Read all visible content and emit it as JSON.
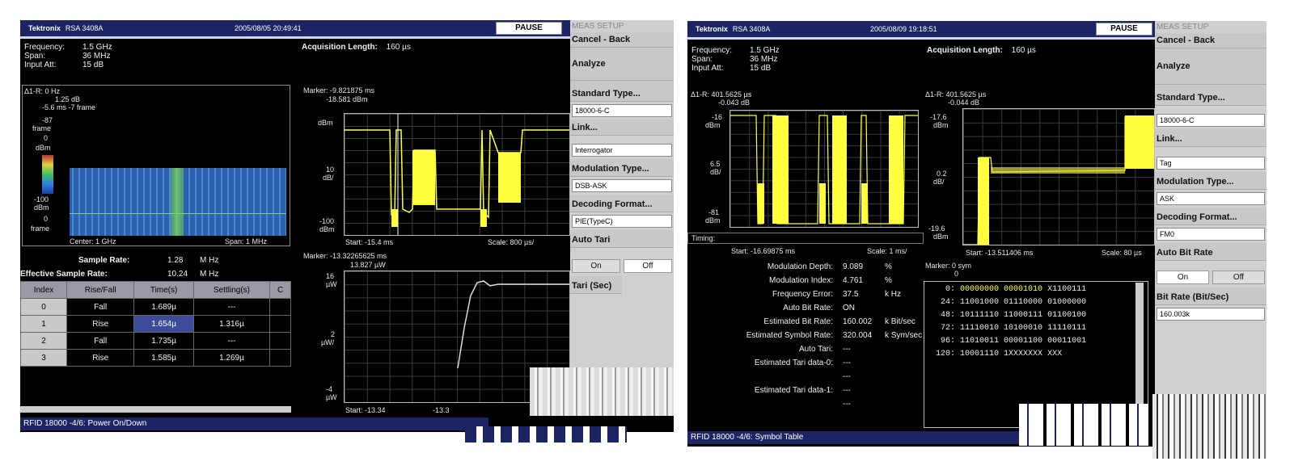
{
  "screens": [
    {
      "brand": "Tektronix",
      "model": "RSA 3408A",
      "timestamp": "2005/08/05 20:49:41",
      "pause": "PAUSE",
      "info": [
        {
          "k": "Frequency:",
          "v": "1.5 GHz"
        },
        {
          "k": "Span:",
          "v": "36 MHz"
        },
        {
          "k": "Input Att:",
          "v": "15 dB"
        }
      ],
      "acq_label": "Acquisition Length:",
      "acq_value": "160 µs",
      "spectro": {
        "line1": "Δ1-R: 0 Hz",
        "line2": "1.25 dB",
        "line3": "-5.6 ms  -7 frame",
        "ticks": [
          "-87",
          "frame",
          "0",
          "dBm",
          "-100",
          "dBm",
          "0",
          "frame"
        ],
        "center": "Center: 1 GHz",
        "span": "Span: 1 MHz"
      },
      "rate": {
        "sample_k": "Sample Rate:",
        "sample_v": "1.28",
        "sample_u": "M Hz",
        "eff_k": "Effective Sample Rate:",
        "eff_v": "10.24",
        "eff_u": "M Hz"
      },
      "table": {
        "headers": [
          "Index",
          "Rise/Fall",
          "Time(s)",
          "Settling(s)",
          "C"
        ],
        "rows": [
          [
            "0",
            "Fall",
            "1.689µ",
            "---"
          ],
          [
            "1",
            "Rise",
            "1.654µ",
            "1.316µ"
          ],
          [
            "2",
            "Fall",
            "1.735µ",
            "---"
          ],
          [
            "3",
            "Rise",
            "1.585µ",
            "1.269µ"
          ]
        ]
      },
      "top_plot": {
        "marker1": "Marker: -9.821875 ms",
        "marker2": "-18.581 dBm",
        "y": [
          "dBm",
          "10",
          "dB/",
          "-100",
          "dBm"
        ],
        "start": "Start: -15.4 ms",
        "scale": "Scale: 800 µs/"
      },
      "bot_plot": {
        "marker1": "Marker: -13.32265625 ms",
        "marker2": "13.827 µW",
        "y": [
          "16",
          "µW",
          "2",
          "µW/",
          "-4",
          "µW"
        ],
        "start": "Start: -13.34",
        "scale": "-13.3"
      },
      "menu": {
        "header": "MEAS SETUP",
        "cancel": "Cancel - Back",
        "analyze": "Analyze",
        "std": "Standard Type...",
        "std_val": "18000-6-C",
        "link": "Link...",
        "link_val": "Interrogator",
        "mod": "Modulation Type...",
        "mod_val": "DSB-ASK",
        "dec": "Decoding Format...",
        "dec_val": "PIE(TypeC)",
        "auto": "Auto Tari",
        "on": "On",
        "off": "Off",
        "last": "Tari (Sec)"
      },
      "status": "RFID 18000  -4/6: Power On/Down"
    },
    {
      "brand": "Tektronix",
      "model": "RSA 3408A",
      "timestamp": "2005/08/09 19:18:51",
      "pause": "PAUSE",
      "info": [
        {
          "k": "Frequency:",
          "v": "1.5 GHz"
        },
        {
          "k": "Span:",
          "v": "36 MHz"
        },
        {
          "k": "Input Att:",
          "v": "15 dB"
        }
      ],
      "acq_label": "Acquisition Length:",
      "acq_value": "160 µs",
      "left_plot": {
        "delta": "Δ1-R: 401.5625 µs",
        "delta2": "-0.043 dB",
        "y": [
          "-16",
          "dBm",
          "6.5",
          "dB/",
          "-81",
          "dBm"
        ],
        "timing": "Timing:",
        "start": "Start: -16.69875 ms",
        "scale": "Scale: 1 ms/"
      },
      "right_plot": {
        "delta": "Δ1-R: 401.5625 µs",
        "delta2": "-0.044 dB",
        "y": [
          "-17.6",
          "dBm",
          "0.2",
          "dB/",
          "-19.6",
          "dBm"
        ],
        "start": "Start: -13.511406 ms",
        "scale": "Scale: 80 µs"
      },
      "meas": [
        {
          "k": "Modulation Depth:",
          "v": "9.089",
          "u": "%"
        },
        {
          "k": "Modulation Index:",
          "v": "4.761",
          "u": "%"
        },
        {
          "k": "Frequency Error:",
          "v": "37.5",
          "u": "k Hz"
        },
        {
          "k": "Auto Bit Rate:",
          "v": "ON",
          "u": ""
        },
        {
          "k": "Estimated Bit Rate:",
          "v": "160.002",
          "u": "k Bit/sec"
        },
        {
          "k": "Estimated Symbol Rate:",
          "v": "320.004",
          "u": "k Sym/sec"
        },
        {
          "k": "Auto Tari:",
          "v": "---",
          "u": ""
        },
        {
          "k": "Estimated Tari data-0:",
          "v": "---",
          "u": ""
        },
        {
          "k": "",
          "v": "---",
          "u": ""
        },
        {
          "k": "Estimated Tari data-1:",
          "v": "---",
          "u": ""
        },
        {
          "k": "",
          "v": "---",
          "u": ""
        }
      ],
      "symbols": {
        "marker": "Marker: 0 sym",
        "marker2": "0",
        "rows": [
          {
            "i": "0:",
            "a": "00000000",
            "b": "00001010",
            "c": "X1100111"
          },
          {
            "i": "24:",
            "a": "11001000",
            "b": "01110000",
            "c": "01000000"
          },
          {
            "i": "48:",
            "a": "10111110",
            "b": "11000111",
            "c": "01100100"
          },
          {
            "i": "72:",
            "a": "11110010",
            "b": "10100010",
            "c": "11110111"
          },
          {
            "i": "96:",
            "a": "11010011",
            "b": "00001100",
            "c": "00011001"
          },
          {
            "i": "120:",
            "a": "10001110",
            "b": "1XXXXXXX",
            "c": "XXX"
          }
        ]
      },
      "menu": {
        "header": "MEAS SETUP",
        "cancel": "Cancel - Back",
        "analyze": "Analyze",
        "std": "Standard Type...",
        "std_val": "18000-6-C",
        "link": "Link...",
        "link_val": "Tag",
        "mod": "Modulation Type...",
        "mod_val": "ASK",
        "dec": "Decoding Format...",
        "dec_val": "FM0",
        "auto": "Auto Bit Rate",
        "on": "On",
        "off": "Off",
        "last": "Bit Rate (Bit/Sec)",
        "last_val": "160.003k"
      },
      "status": "RFID 18000  -4/6: Symbol Table"
    }
  ]
}
